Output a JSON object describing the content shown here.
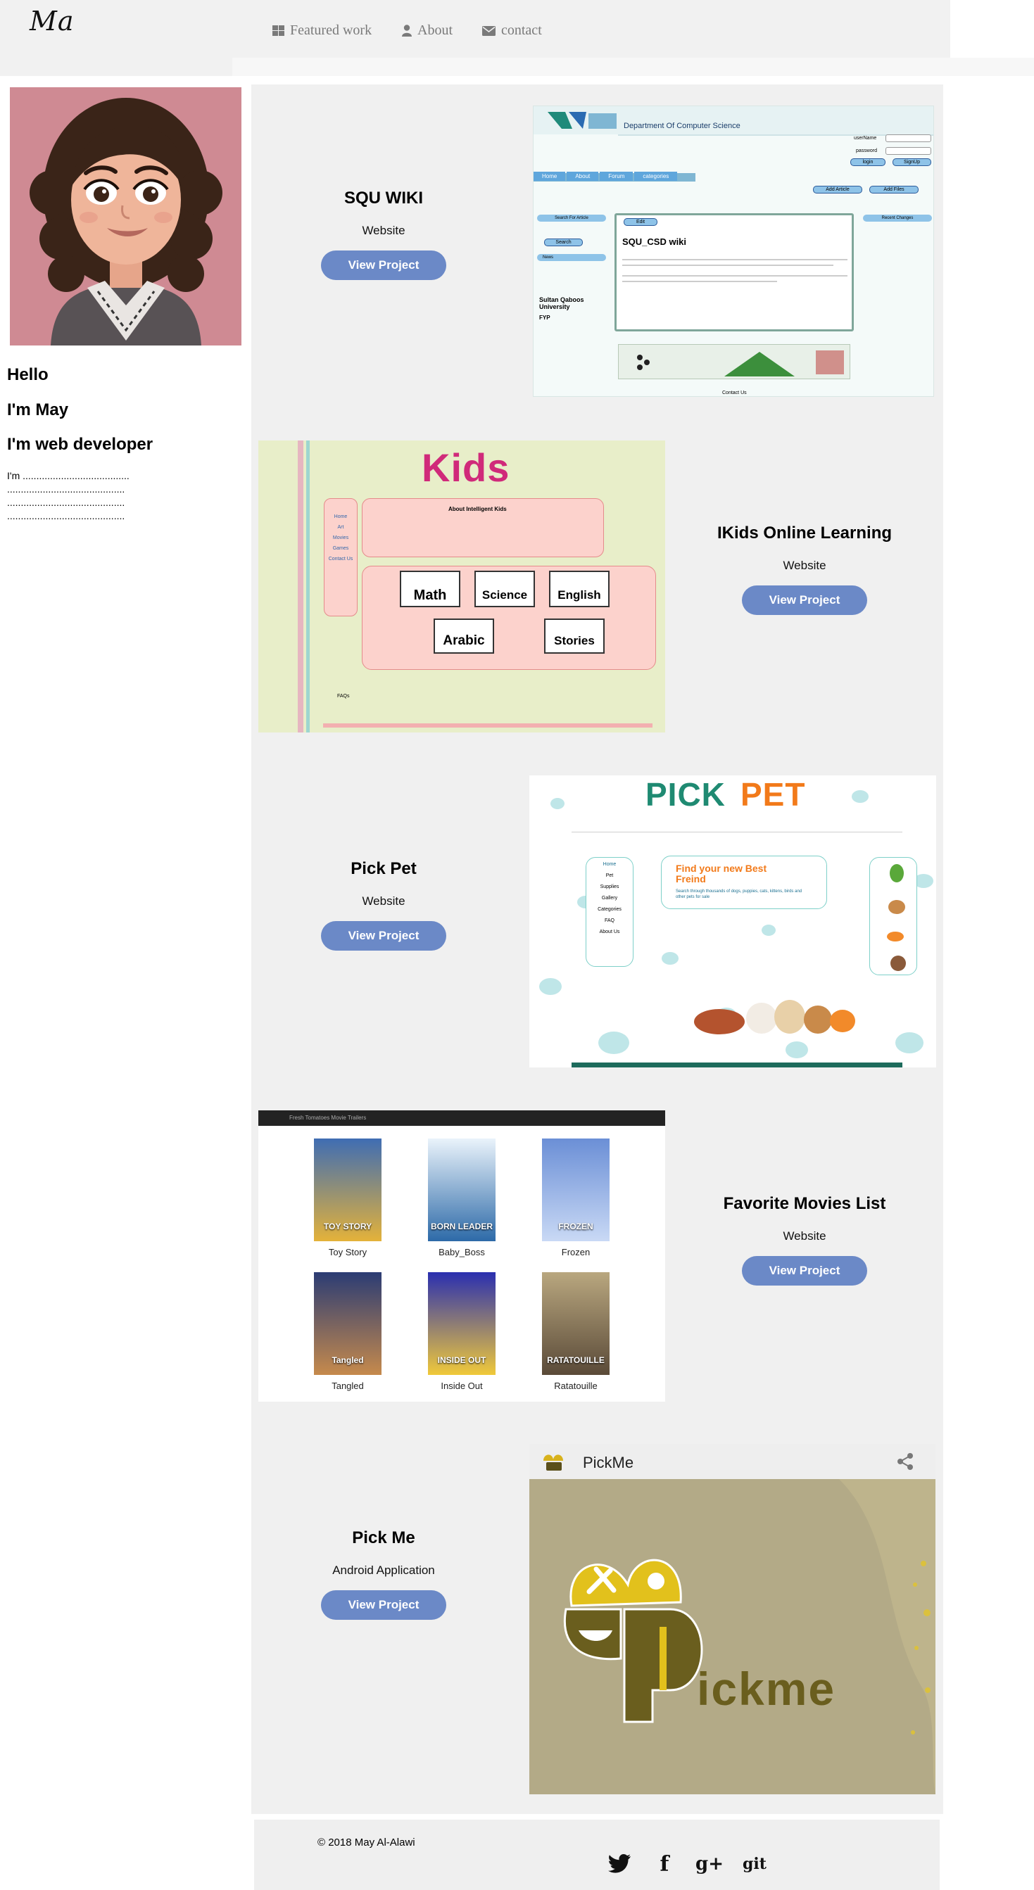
{
  "header": {
    "logo": "Ma",
    "nav": [
      {
        "label": "Featured work",
        "icon": "grid-icon"
      },
      {
        "label": "About",
        "icon": "user-icon"
      },
      {
        "label": "contact",
        "icon": "envelope-icon"
      }
    ]
  },
  "sidebar": {
    "greeting": "Hello",
    "name_line": "I'm May",
    "role_line": "I'm web developer",
    "intro_lines": [
      "I'm .......................................",
      "...........................................",
      "...........................................",
      "..........................................."
    ]
  },
  "projects": [
    {
      "title": "SQU WIKI",
      "type": "Website",
      "button": "View Project",
      "shot": {
        "dept": "Department Of Computer Science",
        "username": "userName",
        "password": "password",
        "login": "login",
        "signup": "SignUp",
        "tabs": [
          "Home",
          "About",
          "Forum",
          "categories"
        ],
        "add_article": "Add Article",
        "add_files": "Add Files",
        "search_article": "Search For Article",
        "search": "Search",
        "news": "News",
        "recent": "Recent Changes",
        "edit": "Edit",
        "wiki_title": "SQU_CSD wiki",
        "university": "Sultan Qaboos University",
        "fyp": "FYP",
        "contact": "Contact Us"
      }
    },
    {
      "title": "IKids Online Learning",
      "type": "Website",
      "button": "View Project",
      "shot": {
        "logo": "Kids",
        "about": "About  Intelligent  Kids",
        "subjects": [
          "Math",
          "Science",
          "English",
          "Arabic",
          "Stories"
        ],
        "menu": [
          "Home",
          "Art",
          "Movies",
          "Games",
          "Contact Us"
        ],
        "faq": "FAQs"
      }
    },
    {
      "title": "Pick Pet",
      "type": "Website",
      "button": "View Project",
      "shot": {
        "logo_a": "PICK",
        "logo_b": "PET",
        "menu": [
          "Home",
          "Pet",
          "Supplies",
          "Gallery",
          "Categories",
          "FAQ",
          "About Us"
        ],
        "headline": "Find your new Best Freind",
        "sub": "Search through thousands of dogs, puppies, cats, kittens, birds and other pets for sale"
      }
    },
    {
      "title": "Favorite Movies List",
      "type": "Website",
      "button": "View Project",
      "shot": {
        "bar": "Fresh Tomatoes Movie Trailers",
        "movies": [
          {
            "name": "Toy Story",
            "poster_title": "TOY STORY",
            "color_a": "#3f6db3",
            "color_b": "#e4b23a"
          },
          {
            "name": "Baby_Boss",
            "poster_title": "BORN LEADER",
            "color_a": "#eaf3fb",
            "color_b": "#2d6aa8"
          },
          {
            "name": "Frozen",
            "poster_title": "FROZEN",
            "color_a": "#6b8fd6",
            "color_b": "#c9d9f5"
          },
          {
            "name": "Tangled",
            "poster_title": "Tangled",
            "color_a": "#2b3c74",
            "color_b": "#c68a4c"
          },
          {
            "name": "Inside Out",
            "poster_title": "INSIDE OUT",
            "color_a": "#2a2fb0",
            "color_b": "#f0c93a"
          },
          {
            "name": "Ratatouille",
            "poster_title": "RATATOUILLE",
            "color_a": "#b9a77f",
            "color_b": "#5a4a38"
          }
        ]
      }
    },
    {
      "title": "Pick Me",
      "type": "Android Application",
      "button": "View Project",
      "shot": {
        "app_name": "PickMe",
        "brand": "ickme"
      }
    }
  ],
  "footer": {
    "copyright": "© 2018 May Al-Alawi",
    "socials": [
      {
        "name": "twitter",
        "glyph": ""
      },
      {
        "name": "facebook",
        "glyph": "f"
      },
      {
        "name": "google-plus",
        "glyph": "g+"
      },
      {
        "name": "git",
        "glyph": "git"
      }
    ]
  }
}
